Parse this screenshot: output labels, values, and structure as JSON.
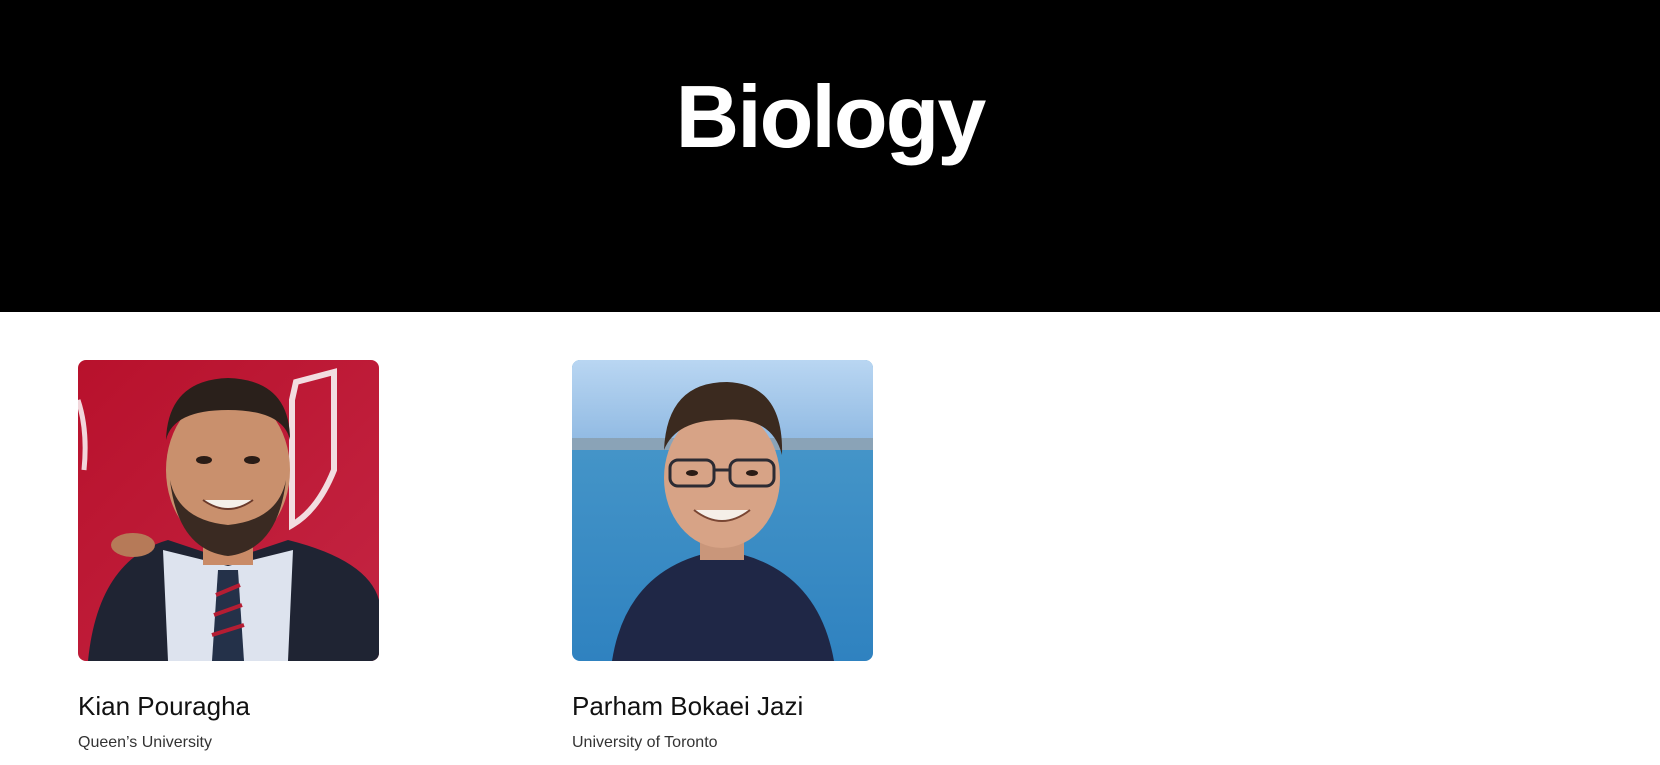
{
  "hero": {
    "title": "Biology",
    "background": "#000000",
    "text_color": "#ffffff"
  },
  "people": [
    {
      "name": "Kian Pouragha",
      "school": "Queen’s University",
      "photo": "portrait-photo"
    },
    {
      "name": "Parham Bokaei Jazi",
      "school": "University of Toronto",
      "photo": "portrait-photo"
    }
  ]
}
